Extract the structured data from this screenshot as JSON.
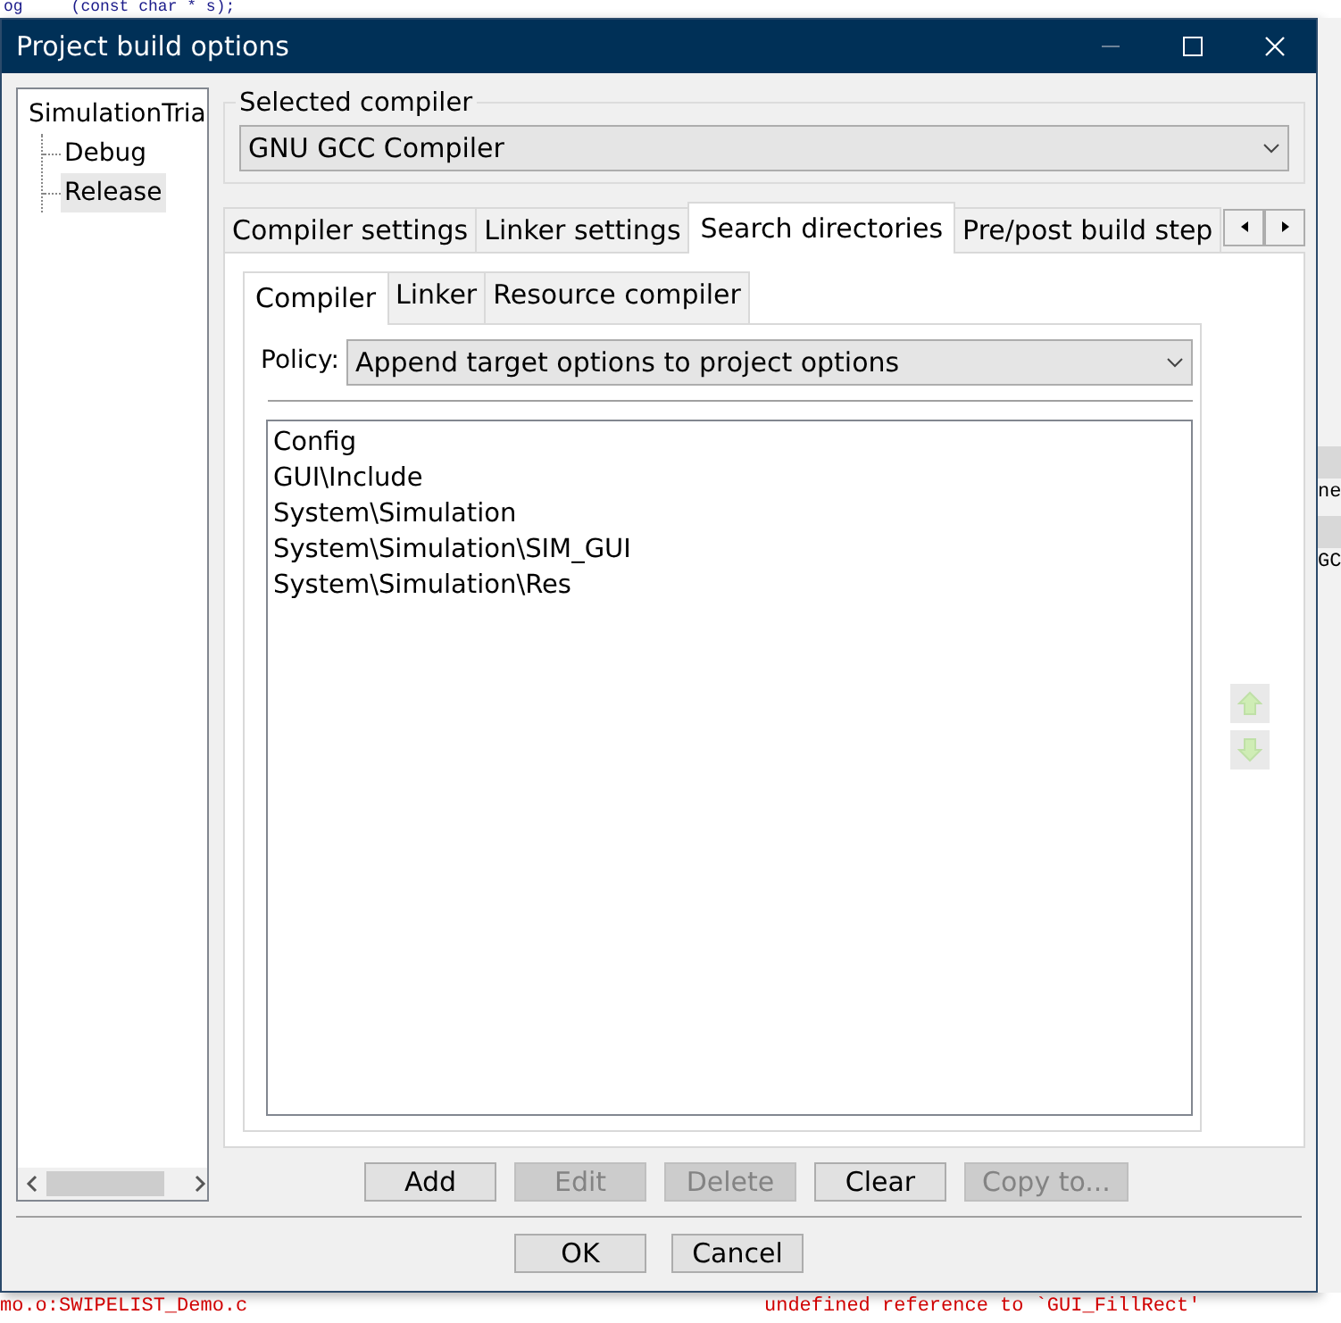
{
  "background": {
    "code_line": "og     (const char * s);",
    "side_fragments": [
      "ne",
      "GC"
    ],
    "log": [
      "mo.o:SWIPELIST_Demo.c",
      "undefined reference to `GUI_FillRect'"
    ]
  },
  "window": {
    "title": "Project build options"
  },
  "tree": [
    {
      "label": "SimulationTria",
      "selected": false,
      "children": [
        {
          "label": "Debug",
          "selected": false
        },
        {
          "label": "Release",
          "selected": true
        }
      ]
    }
  ],
  "compiler": {
    "label": "Selected compiler",
    "value": "GNU GCC Compiler"
  },
  "tabs": [
    {
      "label": "Compiler settings",
      "selected": false
    },
    {
      "label": "Linker settings",
      "selected": false
    },
    {
      "label": "Search directories",
      "selected": true
    },
    {
      "label": "Pre/post build step",
      "selected": false
    }
  ],
  "subtabs": [
    {
      "label": "Compiler",
      "selected": true
    },
    {
      "label": "Linker",
      "selected": false
    },
    {
      "label": "Resource compiler",
      "selected": false
    }
  ],
  "policy": {
    "label": "Policy:",
    "value": "Append target options to project options"
  },
  "directories": [
    "Config",
    "GUI\\Include",
    "System\\Simulation",
    "System\\Simulation\\SIM_GUI",
    "System\\Simulation\\Res"
  ],
  "move_buttons": [
    {
      "kind": "up",
      "disabled": true
    },
    {
      "kind": "down",
      "disabled": true
    }
  ],
  "buttons": [
    {
      "label": "Add",
      "disabled": false
    },
    {
      "label": "Edit",
      "disabled": true
    },
    {
      "label": "Delete",
      "disabled": true
    },
    {
      "label": "Clear",
      "disabled": false
    },
    {
      "label": "Copy to...",
      "disabled": true
    }
  ],
  "dialog_buttons": [
    {
      "label": "OK"
    },
    {
      "label": "Cancel"
    }
  ]
}
